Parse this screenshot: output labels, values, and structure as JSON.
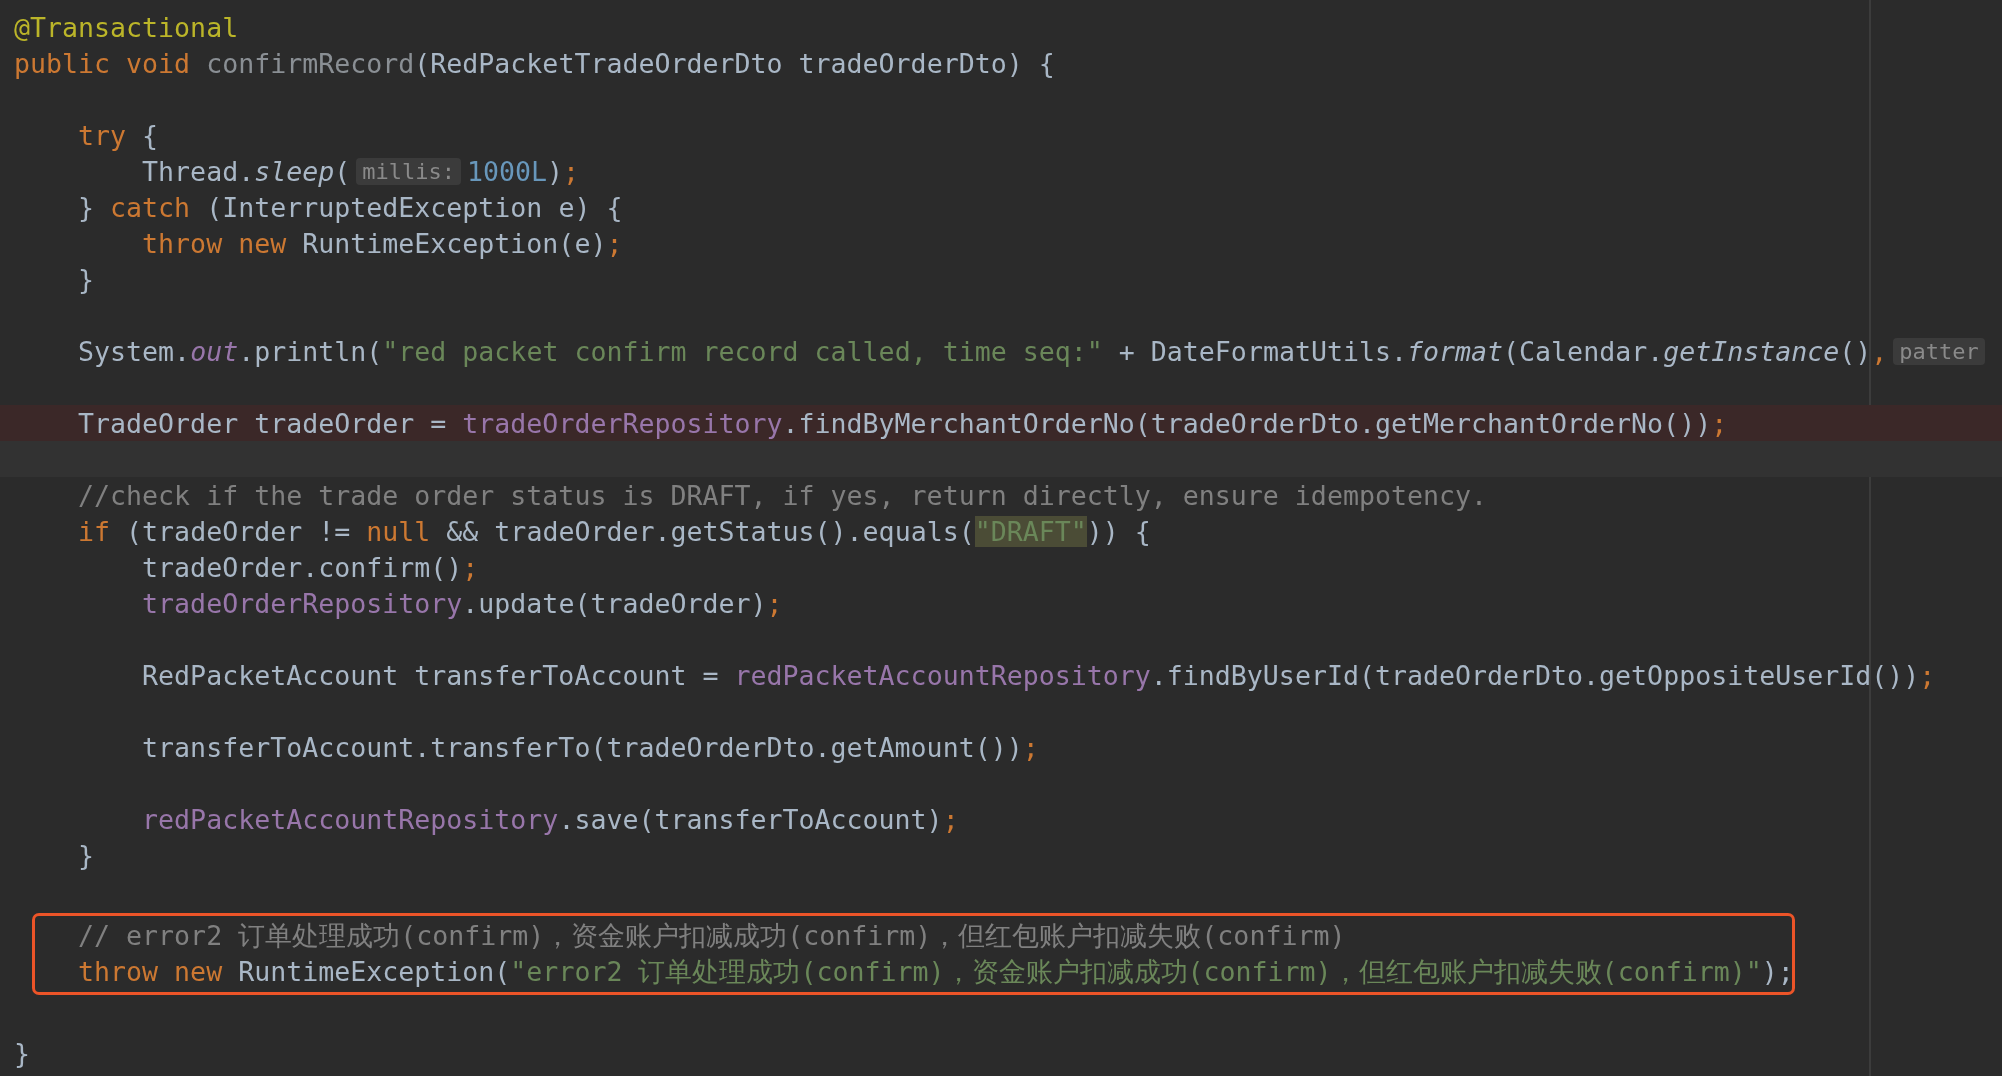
{
  "editor": {
    "lines": [
      {
        "kind": "code",
        "segments": [
          {
            "kind": "code",
            "tokens": [
              {
                "t": "@Transactional",
                "kind": "annotation"
              }
            ]
          }
        ]
      },
      {
        "kind": "code",
        "segments": [
          {
            "kind": "code",
            "tokens": [
              {
                "t": "public void ",
                "kind": "keyword"
              },
              {
                "t": "confirmRecord",
                "kind": "unused"
              },
              {
                "t": "(RedPacketTradeOrderDto tradeOrderDto) {",
                "kind": "plain"
              }
            ]
          }
        ]
      },
      {
        "kind": "blank"
      },
      {
        "kind": "code",
        "segments": [
          {
            "kind": "code",
            "tokens": [
              {
                "t": "    try",
                "kind": "keyword"
              },
              {
                "t": " {",
                "kind": "plain"
              }
            ]
          }
        ]
      },
      {
        "kind": "code",
        "segments": [
          {
            "kind": "code",
            "tokens": [
              {
                "t": "        Thread.",
                "kind": "plain"
              },
              {
                "t": "sleep",
                "kind": "static"
              },
              {
                "t": "(",
                "kind": "plain"
              }
            ]
          },
          {
            "kind": "hint",
            "text": "millis:"
          },
          {
            "kind": "code",
            "tokens": [
              {
                "t": "1000L",
                "kind": "number"
              },
              {
                "t": ")",
                "kind": "plain"
              },
              {
                "t": ";",
                "kind": "keyword"
              }
            ]
          }
        ]
      },
      {
        "kind": "code",
        "segments": [
          {
            "kind": "code",
            "tokens": [
              {
                "t": "    } ",
                "kind": "plain"
              },
              {
                "t": "catch",
                "kind": "keyword"
              },
              {
                "t": " (InterruptedException e) {",
                "kind": "plain"
              }
            ]
          }
        ]
      },
      {
        "kind": "code",
        "segments": [
          {
            "kind": "code",
            "tokens": [
              {
                "t": "        throw new",
                "kind": "keyword"
              },
              {
                "t": " RuntimeException(e)",
                "kind": "plain"
              },
              {
                "t": ";",
                "kind": "keyword"
              }
            ]
          }
        ]
      },
      {
        "kind": "code",
        "segments": [
          {
            "kind": "code",
            "tokens": [
              {
                "t": "    }",
                "kind": "plain"
              }
            ]
          }
        ]
      },
      {
        "kind": "blank"
      },
      {
        "kind": "code",
        "segments": [
          {
            "kind": "code",
            "tokens": [
              {
                "t": "    System.",
                "kind": "plain"
              },
              {
                "t": "out",
                "kind": "static_field"
              },
              {
                "t": ".println(",
                "kind": "plain"
              },
              {
                "t": "\"red packet confirm record called, time seq:\"",
                "kind": "string"
              },
              {
                "t": " + DateFormatUtils.",
                "kind": "plain"
              },
              {
                "t": "format",
                "kind": "static"
              },
              {
                "t": "(Calendar.",
                "kind": "plain"
              },
              {
                "t": "getInstance",
                "kind": "static"
              },
              {
                "t": "()",
                "kind": "plain"
              },
              {
                "t": ",",
                "kind": "keyword"
              }
            ]
          },
          {
            "kind": "hint",
            "text": "patter"
          }
        ]
      },
      {
        "kind": "blank"
      },
      {
        "kind": "breakpoint",
        "segments": [
          {
            "kind": "code",
            "tokens": [
              {
                "t": "    TradeOrder tradeOrder = ",
                "kind": "plain"
              },
              {
                "t": "tradeOrderRepository",
                "kind": "field"
              },
              {
                "t": ".findByMerchantOrderNo(tradeOrderDto.getMerchantOrderNo())",
                "kind": "plain"
              },
              {
                "t": ";",
                "kind": "keyword"
              }
            ]
          }
        ]
      },
      {
        "kind": "caret"
      },
      {
        "kind": "code",
        "segments": [
          {
            "kind": "code",
            "tokens": [
              {
                "t": "    //check if the trade order status is DRAFT, if yes, return directly, ensure idempotency.",
                "kind": "comment"
              }
            ]
          }
        ]
      },
      {
        "kind": "code",
        "segments": [
          {
            "kind": "code",
            "tokens": [
              {
                "t": "    if",
                "kind": "keyword"
              },
              {
                "t": " (tradeOrder != ",
                "kind": "plain"
              },
              {
                "t": "null",
                "kind": "keyword"
              },
              {
                "t": " && tradeOrder.getStatus().equals(",
                "kind": "plain"
              },
              {
                "t": "\"DRAFT\"",
                "kind": "string_match"
              },
              {
                "t": ")) {",
                "kind": "plain"
              }
            ]
          }
        ]
      },
      {
        "kind": "code",
        "segments": [
          {
            "kind": "code",
            "tokens": [
              {
                "t": "        tradeOrder.confirm()",
                "kind": "plain"
              },
              {
                "t": ";",
                "kind": "keyword"
              }
            ]
          }
        ]
      },
      {
        "kind": "code",
        "segments": [
          {
            "kind": "code",
            "tokens": [
              {
                "t": "        tradeOrderRepository",
                "kind": "field"
              },
              {
                "t": ".update(tradeOrder)",
                "kind": "plain"
              },
              {
                "t": ";",
                "kind": "keyword"
              }
            ]
          }
        ]
      },
      {
        "kind": "blank"
      },
      {
        "kind": "code",
        "segments": [
          {
            "kind": "code",
            "tokens": [
              {
                "t": "        RedPacketAccount transferToAccount = ",
                "kind": "plain"
              },
              {
                "t": "redPacketAccountRepository",
                "kind": "field"
              },
              {
                "t": ".findByUserId(tradeOrderDto.getOppositeUserId())",
                "kind": "plain"
              },
              {
                "t": ";",
                "kind": "keyword"
              }
            ]
          }
        ]
      },
      {
        "kind": "blank"
      },
      {
        "kind": "code",
        "segments": [
          {
            "kind": "code",
            "tokens": [
              {
                "t": "        transferToAccount.transferTo(tradeOrderDto.getAmount())",
                "kind": "plain"
              },
              {
                "t": ";",
                "kind": "keyword"
              }
            ]
          }
        ]
      },
      {
        "kind": "blank"
      },
      {
        "kind": "code",
        "segments": [
          {
            "kind": "code",
            "tokens": [
              {
                "t": "        redPacketAccountRepository",
                "kind": "field"
              },
              {
                "t": ".save(transferToAccount)",
                "kind": "plain"
              },
              {
                "t": ";",
                "kind": "keyword"
              }
            ]
          }
        ]
      },
      {
        "kind": "code",
        "segments": [
          {
            "kind": "code",
            "tokens": [
              {
                "t": "    }",
                "kind": "plain"
              }
            ]
          }
        ]
      },
      {
        "kind": "blank"
      }
    ],
    "boxed_lines": [
      {
        "kind": "code",
        "segments": [
          {
            "kind": "code",
            "tokens": [
              {
                "t": "    // error2 订单处理成功(confirm)，资金账户扣减成功(confirm)，但红包账户扣减失败(confirm)",
                "kind": "comment"
              }
            ]
          }
        ]
      },
      {
        "kind": "code",
        "segments": [
          {
            "kind": "code",
            "tokens": [
              {
                "t": "    throw new",
                "kind": "keyword"
              },
              {
                "t": " RuntimeException(",
                "kind": "plain"
              },
              {
                "t": "\"error2 订单处理成功(confirm)，资金账户扣减成功(confirm)，但红包账户扣减失败(confirm)\"",
                "kind": "string"
              },
              {
                "t": ");",
                "kind": "plain"
              }
            ]
          }
        ]
      }
    ],
    "trailing_lines": [
      {
        "kind": "blank"
      },
      {
        "kind": "code",
        "segments": [
          {
            "kind": "code",
            "tokens": [
              {
                "t": "}",
                "kind": "plain"
              }
            ]
          }
        ]
      }
    ]
  }
}
